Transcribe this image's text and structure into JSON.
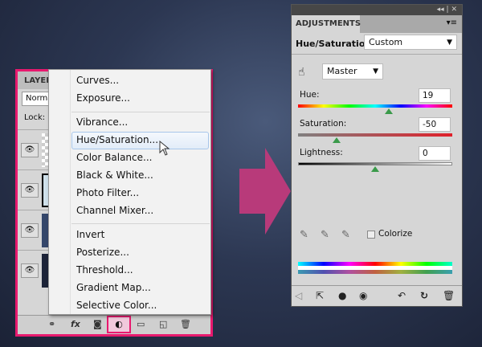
{
  "layers_panel": {
    "title": "LAYER",
    "blend_mode": "Norma",
    "lock_label": "Lock:",
    "eye": "👁",
    "toolbar": [
      {
        "name": "link-icon",
        "glyph": "⚭"
      },
      {
        "name": "fx-icon",
        "glyph": "fx"
      },
      {
        "name": "mask-icon",
        "glyph": "◙"
      },
      {
        "name": "adjustment-layer-icon",
        "glyph": "◐"
      },
      {
        "name": "group-icon",
        "glyph": "▭"
      },
      {
        "name": "new-layer-icon",
        "glyph": "◱"
      },
      {
        "name": "trash-icon",
        "glyph": "🗑"
      }
    ]
  },
  "menu": {
    "items": [
      "Curves...",
      "Exposure...",
      "Vibrance...",
      "Hue/Saturation...",
      "Color Balance...",
      "Black & White...",
      "Photo Filter...",
      "Channel Mixer...",
      "Invert",
      "Posterize...",
      "Threshold...",
      "Gradient Map...",
      "Selective Color..."
    ],
    "highlighted": "Hue/Saturation..."
  },
  "adjustments": {
    "tab": "ADJUSTMENTS",
    "panel_controls": "◂◂ | ✕",
    "menu_icon": "▾≡",
    "title": "Hue/Saturation",
    "preset": "Custom",
    "channel": "Master",
    "hue": {
      "label": "Hue:",
      "value": "19"
    },
    "saturation": {
      "label": "Saturation:",
      "value": "-50"
    },
    "lightness": {
      "label": "Lightness:",
      "value": "0"
    },
    "colorize_label": "Colorize"
  },
  "colors": {
    "highlight_border": "#e8196e",
    "arrow": "#b83a7a"
  }
}
